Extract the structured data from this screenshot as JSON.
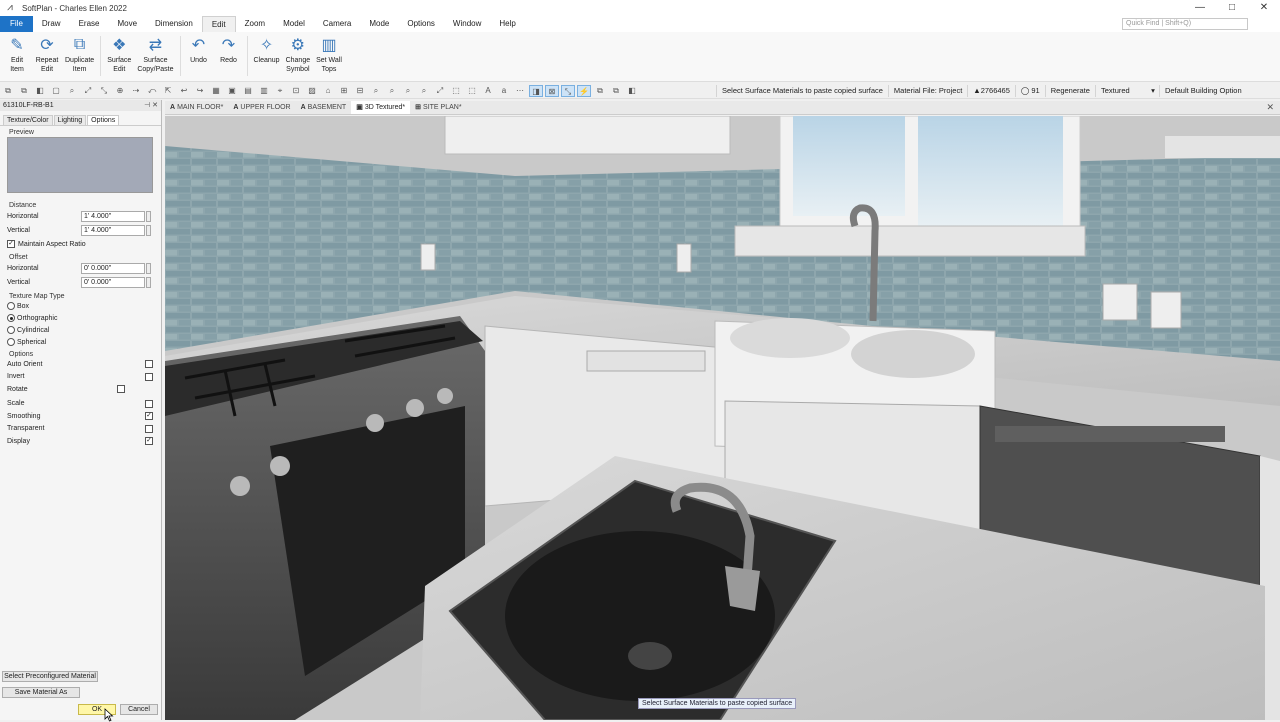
{
  "app": {
    "title": "SoftPlan - Charles Ellen 2022"
  },
  "window_controls": {
    "minimize": "—",
    "maximize": "□",
    "close": "✕"
  },
  "menu": {
    "items": [
      "File",
      "Draw",
      "Erase",
      "Move",
      "Dimension",
      "Edit",
      "Zoom",
      "Model",
      "Camera",
      "Mode",
      "Options",
      "Window",
      "Help"
    ],
    "active": "Edit",
    "quick_find_placeholder": "Quick Find | Shift+Q)"
  },
  "ribbon": {
    "buttons": [
      {
        "label": "Edit\nItem",
        "icon": "edit-item-icon"
      },
      {
        "label": "Repeat\nEdit",
        "icon": "repeat-edit-icon"
      },
      {
        "label": "Duplicate\nItem",
        "icon": "duplicate-item-icon"
      },
      {
        "label": "Surface\nEdit",
        "icon": "surface-edit-icon"
      },
      {
        "label": "Surface\nCopy/Paste",
        "icon": "surface-copy-paste-icon"
      },
      {
        "label": "Undo",
        "icon": "undo-icon"
      },
      {
        "label": "Redo",
        "icon": "redo-icon"
      },
      {
        "label": "Cleanup",
        "icon": "cleanup-icon"
      },
      {
        "label": "Change\nSymbol",
        "icon": "change-symbol-icon"
      },
      {
        "label": "Set Wall\nTops",
        "icon": "set-wall-tops-icon"
      }
    ]
  },
  "toolbar": {
    "prompt": "Select Surface Materials to paste copied surface",
    "material_file": "Material File: Project",
    "count_a": "▲2766465",
    "count_b": "◯ 91",
    "regenerate": "Regenerate",
    "render_mode": "Textured",
    "building_option": "Default Building Option"
  },
  "panel": {
    "header": "61310LF-RB-B1",
    "tabs": [
      "Texture/Color",
      "Lighting",
      "Options"
    ],
    "active_tab": "Options",
    "preview_label": "Preview",
    "preview_color": "#a3a9b7",
    "distance": {
      "label": "Distance",
      "horizontal_label": "Horizontal",
      "horizontal": "1' 4.000\"",
      "vertical_label": "Vertical",
      "vertical": "1' 4.000\"",
      "maintain_label": "Maintain Aspect Ratio",
      "maintain": true
    },
    "offset": {
      "label": "Offset",
      "horizontal_label": "Horizontal",
      "horizontal": "0' 0.000\"",
      "vertical_label": "Vertical",
      "vertical": "0' 0.000\""
    },
    "map_type": {
      "label": "Texture Map Type",
      "options": [
        "Box",
        "Orthographic",
        "Cylindrical",
        "Spherical"
      ],
      "selected": "Orthographic"
    },
    "options": {
      "label": "Options",
      "items": [
        {
          "label": "Auto Orient",
          "checked": false
        },
        {
          "label": "Invert",
          "checked": false
        },
        {
          "label": "Rotate",
          "checked": false
        },
        {
          "label": "Scale",
          "checked": false
        },
        {
          "label": "Smoothing",
          "checked": true
        },
        {
          "label": "Transparent",
          "checked": false
        },
        {
          "label": "Display",
          "checked": true
        }
      ]
    },
    "select_preconfigured": "Select Preconfigured Material",
    "save_material_as": "Save Material As",
    "ok": "OK",
    "cancel": "Cancel"
  },
  "view_tabs": [
    {
      "label": "MAIN FLOOR*",
      "active": false
    },
    {
      "label": "UPPER FLOOR",
      "active": false
    },
    {
      "label": "BASEMENT",
      "active": false
    },
    {
      "label": "3D Textured*",
      "active": true
    },
    {
      "label": "SITE PLAN*",
      "active": false
    }
  ],
  "status_tooltip": "Select Surface Materials to paste copied surface"
}
